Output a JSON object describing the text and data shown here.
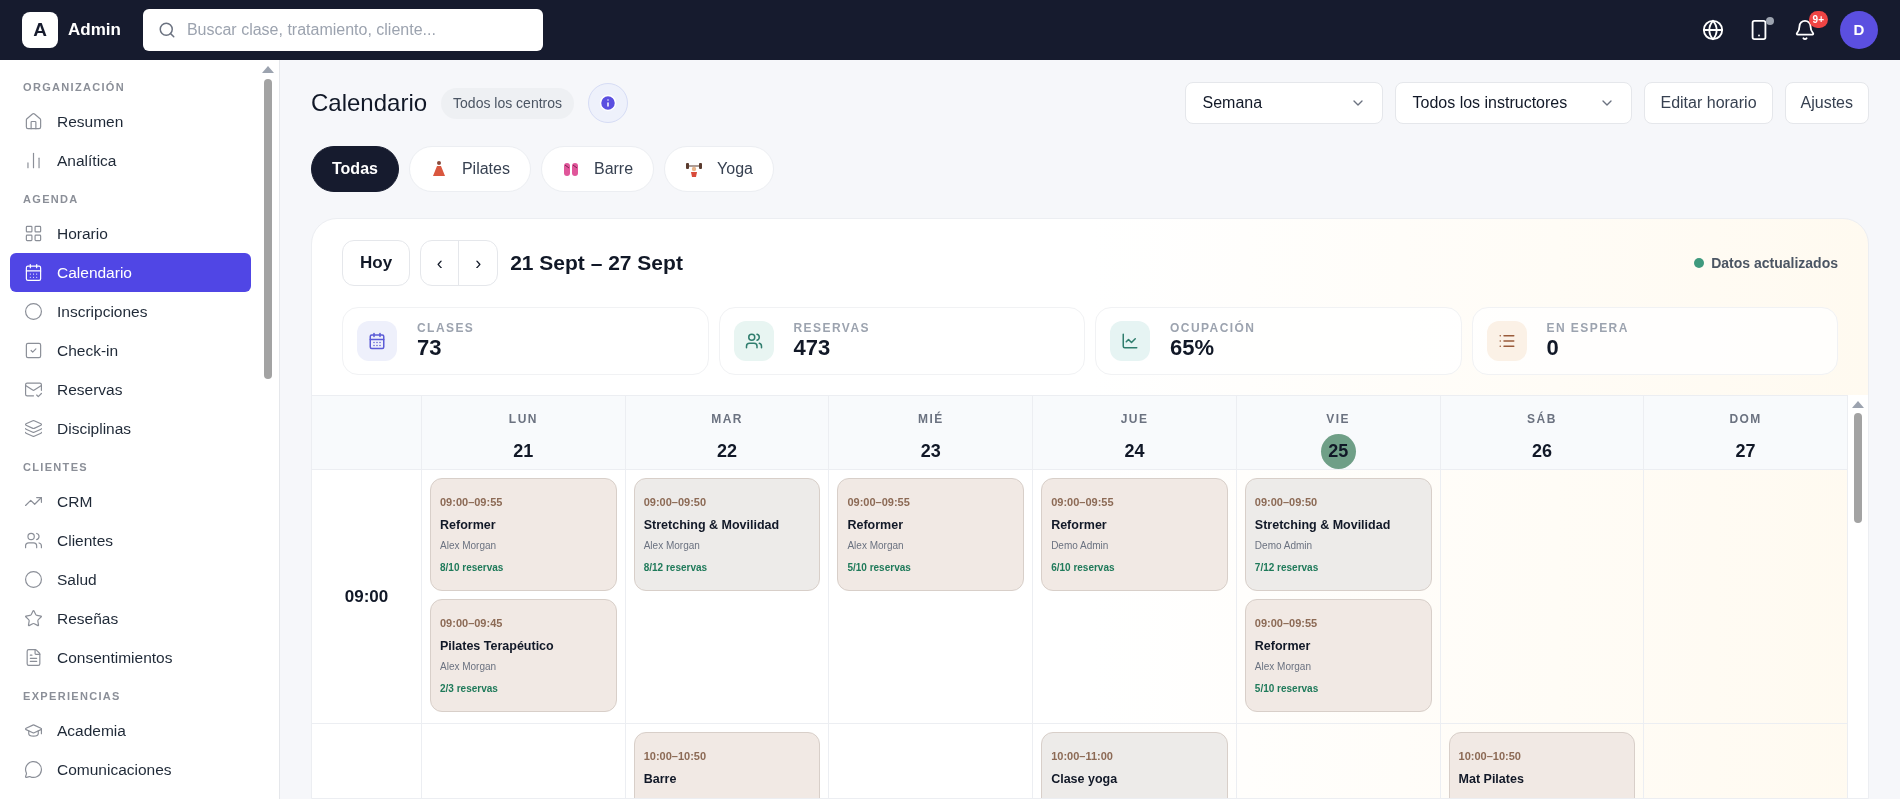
{
  "topbar": {
    "logo_letter": "A",
    "app_name": "Admin",
    "search": {
      "placeholder": "Buscar clase, tratamiento, cliente..."
    },
    "notifications_badge": "9+",
    "avatar_letter": "D"
  },
  "sidebar": {
    "sections": [
      {
        "title": "ORGANIZACIÓN",
        "items": [
          {
            "label": "Resumen",
            "selected": false
          },
          {
            "label": "Analítica",
            "selected": false
          }
        ]
      },
      {
        "title": "AGENDA",
        "items": [
          {
            "label": "Horario",
            "selected": false
          },
          {
            "label": "Calendario",
            "selected": true
          },
          {
            "label": "Inscripciones",
            "selected": false
          },
          {
            "label": "Check-in",
            "selected": false
          },
          {
            "label": "Reservas",
            "selected": false
          },
          {
            "label": "Disciplinas",
            "selected": false
          }
        ]
      },
      {
        "title": "CLIENTES",
        "items": [
          {
            "label": "CRM",
            "selected": false
          },
          {
            "label": "Clientes",
            "selected": false
          },
          {
            "label": "Salud",
            "selected": false
          },
          {
            "label": "Reseñas",
            "selected": false
          },
          {
            "label": "Consentimientos",
            "selected": false
          }
        ]
      },
      {
        "title": "EXPERIENCIAS",
        "items": [
          {
            "label": "Academia",
            "selected": false
          },
          {
            "label": "Comunicaciones",
            "selected": false
          }
        ]
      }
    ]
  },
  "header": {
    "title": "Calendario",
    "location_chip": "Todos los centros",
    "view_select": "Semana",
    "instructor_select": "Todos los instructores",
    "buttons": [
      "Editar horario",
      "Ajustes"
    ]
  },
  "filters": [
    {
      "label": "Todas",
      "selected": true
    },
    {
      "label": "Pilates",
      "selected": false
    },
    {
      "label": "Barre",
      "selected": false
    },
    {
      "label": "Yoga",
      "selected": false
    }
  ],
  "calendar": {
    "today_button": "Hoy",
    "prev": "‹",
    "next": "›",
    "range": "21 Sept – 27 Sept",
    "status": "Datos actualizados",
    "stats": [
      {
        "label": "CLASES",
        "value": "73"
      },
      {
        "label": "RESERVAS",
        "value": "473"
      },
      {
        "label": "OCUPACIÓN",
        "value": "65%"
      },
      {
        "label": "EN ESPERA",
        "value": "0"
      }
    ],
    "days": [
      {
        "weekday": "LUN",
        "day": "21",
        "today": false
      },
      {
        "weekday": "MAR",
        "day": "22",
        "today": false
      },
      {
        "weekday": "MIÉ",
        "day": "23",
        "today": false
      },
      {
        "weekday": "JUE",
        "day": "24",
        "today": false
      },
      {
        "weekday": "VIE",
        "day": "25",
        "today": true
      },
      {
        "weekday": "SÁB",
        "day": "26",
        "today": false
      },
      {
        "weekday": "DOM",
        "day": "27",
        "today": false
      }
    ],
    "rows": [
      {
        "time": "09:00",
        "cells": [
          [
            {
              "time": "09:00–09:55",
              "title": "Reformer",
              "instructor": "Alex Morgan",
              "bookings": "8/10 reservas",
              "color": "#f1e9e4"
            },
            {
              "time": "09:00–09:45",
              "title": "Pilates Terapéutico",
              "instructor": "Alex Morgan",
              "bookings": "2/3 reservas",
              "color": "#f1e9e4"
            }
          ],
          [
            {
              "time": "09:00–09:50",
              "title": "Stretching & Movilidad",
              "instructor": "Alex Morgan",
              "bookings": "8/12 reservas",
              "color": "#edebe9"
            }
          ],
          [
            {
              "time": "09:00–09:55",
              "title": "Reformer",
              "instructor": "Alex Morgan",
              "bookings": "5/10 reservas",
              "color": "#f1e9e4"
            }
          ],
          [
            {
              "time": "09:00–09:55",
              "title": "Reformer",
              "instructor": "Demo Admin",
              "bookings": "6/10 reservas",
              "color": "#f1e9e4"
            }
          ],
          [
            {
              "time": "09:00–09:50",
              "title": "Stretching & Movilidad",
              "instructor": "Demo Admin",
              "bookings": "7/12 reservas",
              "color": "#edebe9"
            },
            {
              "time": "09:00–09:55",
              "title": "Reformer",
              "instructor": "Alex Morgan",
              "bookings": "5/10 reservas",
              "color": "#f1e9e4"
            }
          ],
          [],
          []
        ]
      },
      {
        "cells": [
          [],
          [
            {
              "time": "10:00–10:50",
              "title": "Barre",
              "color": "#f1e9e4"
            }
          ],
          [],
          [
            {
              "time": "10:00–11:00",
              "title": "Clase yoga",
              "color": "#edebe9"
            }
          ],
          [],
          [
            {
              "time": "10:00–10:50",
              "title": "Mat Pilates",
              "color": "#f1e9e4"
            }
          ],
          []
        ]
      }
    ]
  }
}
